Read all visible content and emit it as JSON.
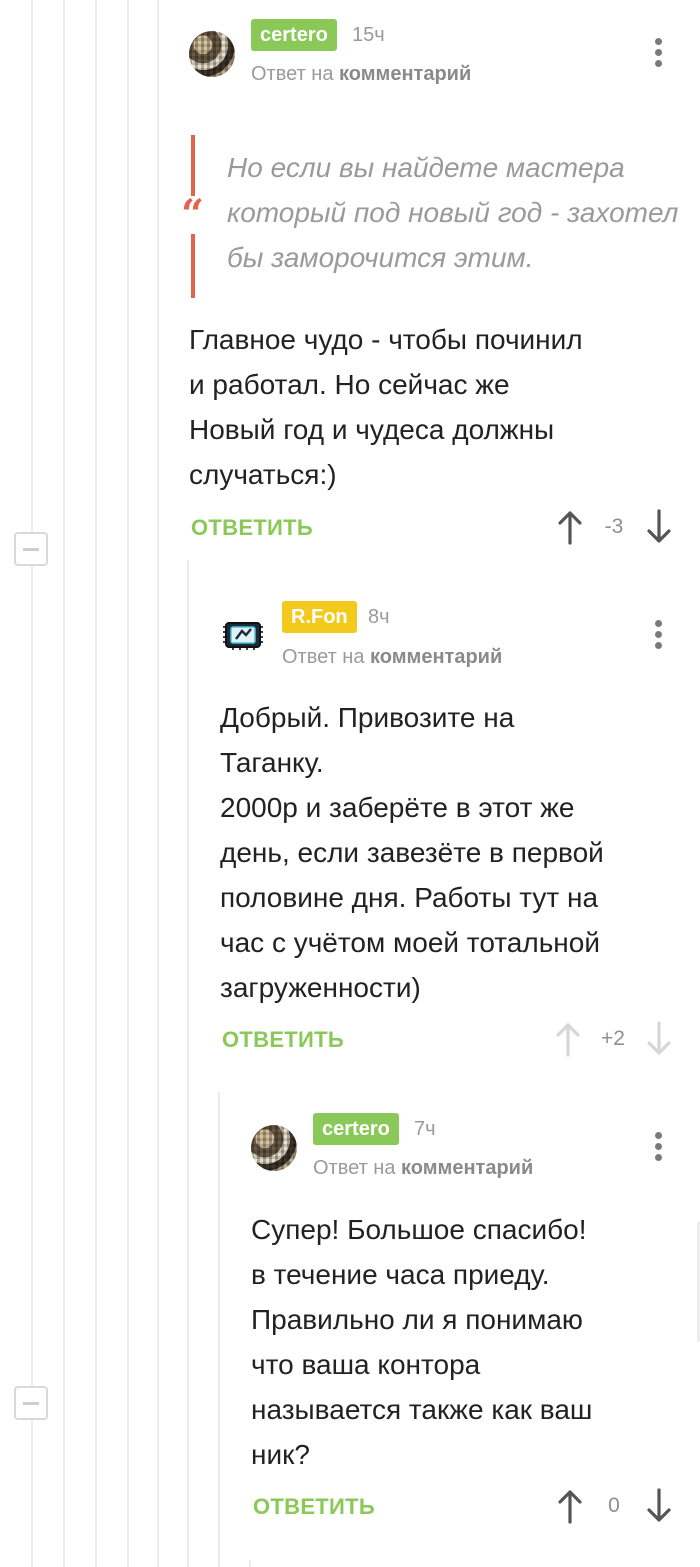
{
  "comments": [
    {
      "author": "certero",
      "time": "15ч",
      "reply_prefix": "Ответ на",
      "reply_target": "комментарий",
      "quote": "Но если вы найдете мастера который под новый год - захотел бы заморочится этим.",
      "quote_mark": "“",
      "text": "Главное чудо - чтобы починил\nи работал.  Но сейчас же\nНовый год и чудеса должны\nслучаться:)",
      "reply_label": "ОТВЕТИТЬ",
      "score": "-3"
    },
    {
      "author": "R.Fon",
      "time": "8ч",
      "reply_prefix": "Ответ на",
      "reply_target": "комментарий",
      "text": "Добрый. Привозите на\nТаганку.\n2000р и заберёте в этот же\nдень, если завезёте в первой\nполовине дня. Работы тут на\nчас с учётом моей тотальной\nзагруженности)",
      "reply_label": "ОТВЕТИТЬ",
      "score": "+2"
    },
    {
      "author": "certero",
      "time": "7ч",
      "reply_prefix": "Ответ на",
      "reply_target": "комментарий",
      "text": "Супер! Большое спасибо!\nв течение часа приеду.\nПравильно ли я понимаю\nчто ваша контора\nназывается также как ваш\nник?",
      "reply_label": "ОТВЕТИТЬ",
      "score": "0"
    }
  ],
  "icons": {
    "collapse": "minus-square-icon",
    "menu": "vertical-dots-icon",
    "upvote": "arrow-up-icon",
    "downvote": "arrow-down-icon"
  },
  "colors": {
    "accent_green": "#8ac858",
    "badge_yellow": "#f3c91b",
    "quote_red": "#e0644e"
  }
}
